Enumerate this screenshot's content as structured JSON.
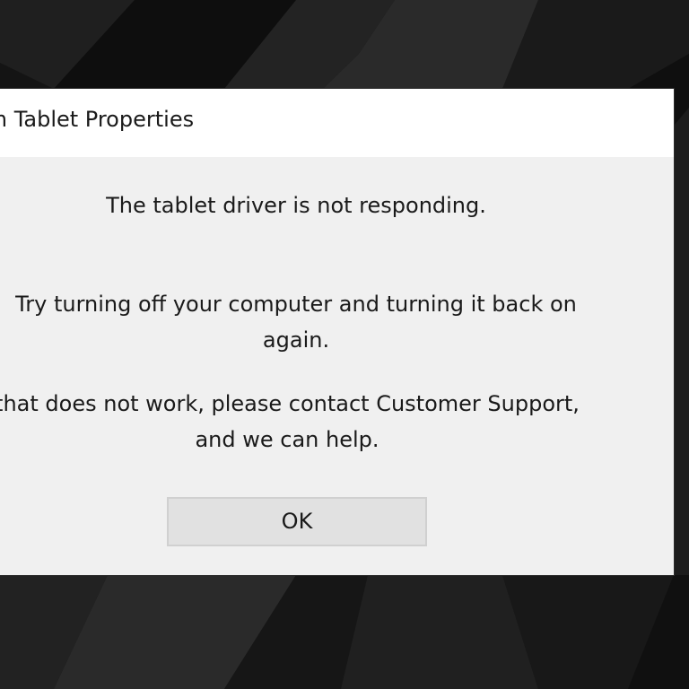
{
  "dialog": {
    "title": "om Tablet Properties",
    "message_primary": "The tablet driver is not responding.",
    "message_restart_line1": "Try turning off your computer and turning it back on",
    "message_restart_line2": "again.",
    "message_support_line1": "that does not work, please contact Customer Support,",
    "message_support_line2": "and we can help.",
    "ok_label": "OK"
  },
  "colors": {
    "wallpaper": "#141414",
    "dialog_body": "#f0f0f0",
    "titlebar": "#ffffff",
    "button": "#e1e1e1"
  }
}
